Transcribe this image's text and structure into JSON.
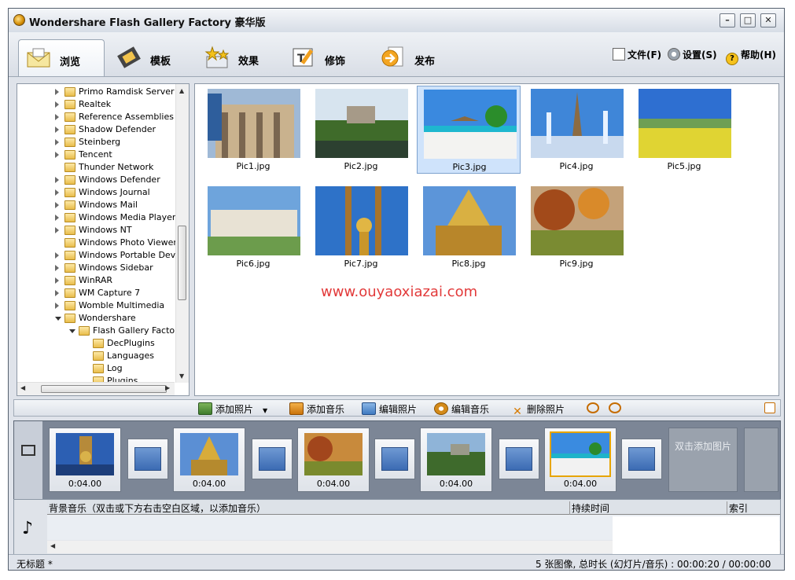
{
  "window": {
    "title": "Wondershare Flash Gallery Factory 豪华版",
    "minimize": "–",
    "maximize": "□",
    "close": "✕"
  },
  "tabs": [
    {
      "label": "浏览"
    },
    {
      "label": "模板"
    },
    {
      "label": "效果"
    },
    {
      "label": "修饰"
    },
    {
      "label": "发布"
    }
  ],
  "menu": {
    "file": "文件(F)",
    "settings": "设置(S)",
    "help": "帮助(H)"
  },
  "tree": {
    "items": [
      {
        "label": "Primo Ramdisk Server Ed"
      },
      {
        "label": "Realtek"
      },
      {
        "label": "Reference Assemblies"
      },
      {
        "label": "Shadow Defender"
      },
      {
        "label": "Steinberg"
      },
      {
        "label": "Tencent"
      },
      {
        "label": "Thunder Network"
      },
      {
        "label": "Windows Defender"
      },
      {
        "label": "Windows Journal"
      },
      {
        "label": "Windows Mail"
      },
      {
        "label": "Windows Media Player"
      },
      {
        "label": "Windows NT"
      },
      {
        "label": "Windows Photo Viewer"
      },
      {
        "label": "Windows Portable Device"
      },
      {
        "label": "Windows Sidebar"
      },
      {
        "label": "WinRAR"
      },
      {
        "label": "WM Capture 7"
      },
      {
        "label": "Womble Multimedia"
      },
      {
        "label": "Wondershare"
      },
      {
        "label": "Flash Gallery Factory"
      },
      {
        "label": "DecPlugins"
      },
      {
        "label": "Languages"
      },
      {
        "label": "Log"
      },
      {
        "label": "Plugins"
      }
    ]
  },
  "gallery": {
    "items": [
      {
        "name": "Pic1.jpg"
      },
      {
        "name": "Pic2.jpg"
      },
      {
        "name": "Pic3.jpg"
      },
      {
        "name": "Pic4.jpg"
      },
      {
        "name": "Pic5.jpg"
      },
      {
        "name": "Pic6.jpg"
      },
      {
        "name": "Pic7.jpg"
      },
      {
        "name": "Pic8.jpg"
      },
      {
        "name": "Pic9.jpg"
      }
    ],
    "watermark": "www.ouyaoxiazai.com"
  },
  "strip_toolbar": {
    "add_photo": "添加照片",
    "add_music": "添加音乐",
    "edit_photo": "编辑照片",
    "edit_music": "编辑音乐",
    "delete_photo": "删除照片"
  },
  "storyboard": {
    "durations": [
      "0:04.00",
      "0:04.00",
      "0:04.00",
      "0:04.00",
      "0:04.00"
    ],
    "add_slot": "双击添加图片"
  },
  "music": {
    "col_bg": "背景音乐（双击或下方右击空白区域，以添加音乐）",
    "col_duration": "持续时间",
    "col_index": "索引"
  },
  "status": {
    "left": "无标题 *",
    "right": "5 张图像, 总时长 (幻灯片/音乐) : 00:00:20 / 00:00:00"
  }
}
